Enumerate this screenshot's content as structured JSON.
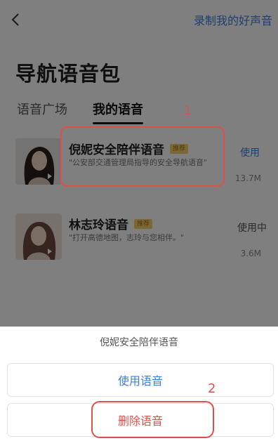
{
  "header": {
    "record_link": "录制我的好声音"
  },
  "page_title": "导航语音包",
  "tabs": [
    {
      "label": "语音广场"
    },
    {
      "label": "我的语音"
    }
  ],
  "voices": [
    {
      "name": "倪妮安全陪伴语音",
      "tag": "推荐",
      "desc": "\"公安部交通管理局指导的安全导航语音\"",
      "action": "使用",
      "size": "13.7M"
    },
    {
      "name": "林志玲语音",
      "tag": "推荐",
      "desc": "\"打开高德地图，志玲与您相伴。\"",
      "action": "使用中",
      "size": "3.6M"
    }
  ],
  "annotations": {
    "n1": "1",
    "n2": "2"
  },
  "sheet": {
    "title": "倪妮安全陪伴语音",
    "use_label": "使用语音",
    "delete_label": "删除语音"
  },
  "colors": {
    "accent": "#3f7de0",
    "danger": "#e0504a",
    "overlay": "rgba(0,0,0,0.5)"
  }
}
